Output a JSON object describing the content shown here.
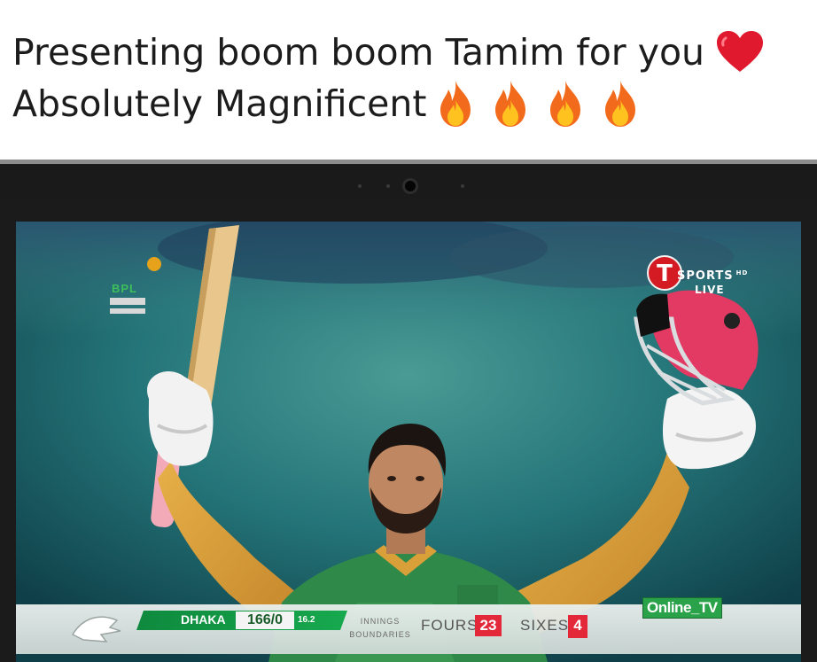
{
  "caption": {
    "line1": "Presenting boom boom Tamim for you",
    "line2": "Absolutely Magnificent",
    "line1_emoji": "heart-emoji",
    "line2_emoji": [
      "fire-emoji",
      "fire-emoji",
      "fire-emoji",
      "fire-emoji"
    ]
  },
  "broadcast": {
    "league_logo_text": "BPL",
    "channel": {
      "logo_letter": "T",
      "name": "SPORTS",
      "suffix": "HD",
      "status": "LIVE"
    },
    "watermark": "Online_TV",
    "scoreboard": {
      "team": "DHAKA",
      "score": "166/0",
      "overs": "16.2",
      "innings_label_top": "INNINGS",
      "innings_label_bottom": "BOUNDARIES",
      "fours_label": "FOURS",
      "fours_value": "23",
      "sixes_label": "SIXES",
      "sixes_value": "4"
    }
  },
  "colors": {
    "caption_text": "#1c1c1c",
    "channel_red": "#d41a23",
    "team_green": "#17a84e",
    "stat_red": "#e3283a",
    "jersey_gold": "#d99a33",
    "jersey_green": "#2f8a4a",
    "stadium_teal": "#1f6f73"
  }
}
